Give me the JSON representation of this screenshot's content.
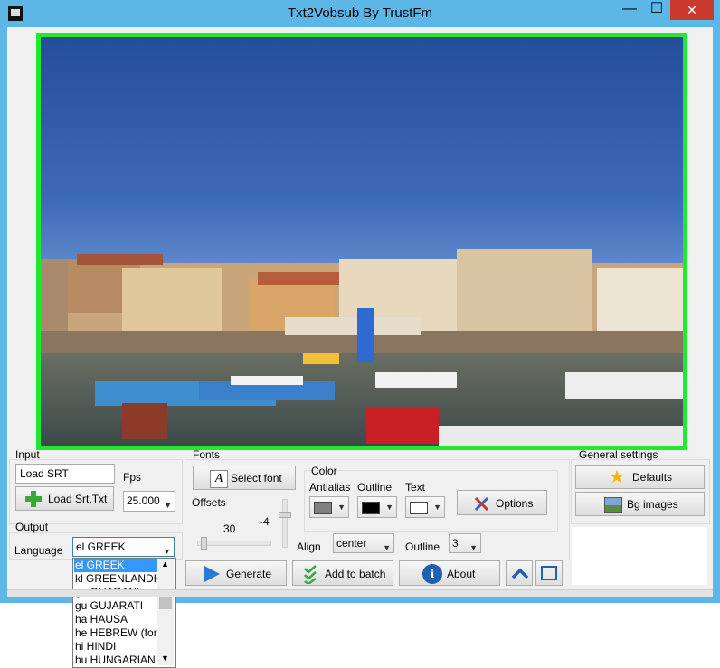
{
  "window": {
    "title": "Txt2Vobsub By TrustFm",
    "minimize": "—",
    "maximize": "☐",
    "close": "✕"
  },
  "input": {
    "group_label": "Input",
    "srt_field_value": "Load SRT",
    "fps_label": "Fps",
    "load_button_label": "Load Srt,Txt",
    "fps_value": "25.000"
  },
  "output": {
    "group_label": "Output",
    "language_label": "Language",
    "language_value": "el GREEK",
    "language_options": [
      "el GREEK",
      "kl GREENLANDIC",
      "gn GUARANI",
      "gu GUJARATI",
      "ha HAUSA",
      "he HEBREW (form",
      "hi HINDI",
      "hu HUNGARIAN"
    ]
  },
  "fonts": {
    "group_label": "Fonts",
    "select_font_label": "Select font",
    "offsets_label": "Offsets",
    "offset_x_value": "30",
    "offset_y_value": "-4",
    "align_label": "Align",
    "align_value": "center",
    "outline_label": "Outline",
    "outline_value": "3"
  },
  "color": {
    "group_label": "Color",
    "antialias_label": "Antialias",
    "outline_label": "Outline",
    "text_label": "Text",
    "antialias_color": "#808080",
    "outline_color": "#000000",
    "text_color": "#ffffff",
    "options_label": "Options"
  },
  "general": {
    "group_label": "General settings",
    "defaults_label": "Defaults",
    "bg_images_label": "Bg images"
  },
  "actions": {
    "generate_label": "Generate",
    "add_batch_label": "Add to batch",
    "about_label": "About"
  },
  "icons": [
    "plus-icon",
    "font-icon",
    "tools-icon",
    "star-icon",
    "picture-icon",
    "play-icon",
    "checkmarks-icon",
    "info-icon",
    "chevron-up-icon",
    "fullscreen-icon"
  ],
  "colors": {
    "preview_border": "#21e92f",
    "selection": "#3399ff",
    "titlebar": "#5cb6e6",
    "close": "#c73a2d"
  }
}
